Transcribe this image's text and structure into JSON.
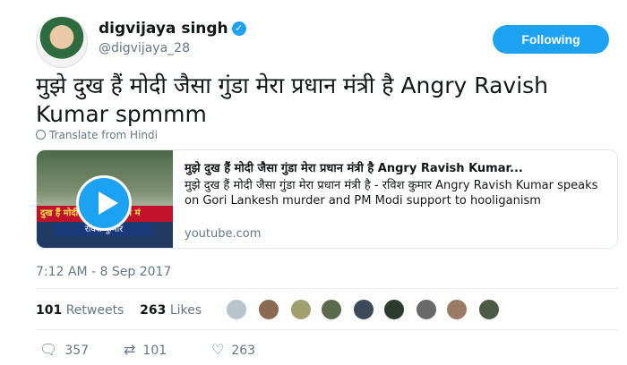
{
  "header": {
    "name": "digvijaya singh",
    "handle": "@digvijaya_28",
    "follow_label": "Following"
  },
  "tweet": {
    "text": "मुझे दुख हैं मोदी जैसा गुंडा मेरा प्रधान मंत्री है Angry Ravish Kumar spmmm",
    "translate_label": "Translate from Hindi",
    "timestamp": "7:12 AM - 8 Sep 2017"
  },
  "card": {
    "title": "मुझे दुख हैं मोदी जैसा गुंडा मेरा प्रधान मंत्री है Angry Ravish Kumar...",
    "description": "मुझे दुख हैं मोदी जैसा गुंडा मेरा प्रधान मंत्री है - रविश कुमार Angry Ravish Kumar speaks on Gori Lankesh murder and PM Modi support to hooliganism",
    "domain": "youtube.com",
    "thumb_band": "दुख हैं मोदी जैसा मेरा प्रधान मं",
    "thumb_band2": "रविश कुमार"
  },
  "stats": {
    "retweets_count": "101",
    "retweets_label": "Retweets",
    "likes_count": "263",
    "likes_label": "Likes"
  },
  "actions": {
    "reply_count": "357",
    "retweet_count": "101",
    "like_count": "263"
  },
  "colors": {
    "accent": "#1da1f2",
    "muted": "#657786"
  }
}
